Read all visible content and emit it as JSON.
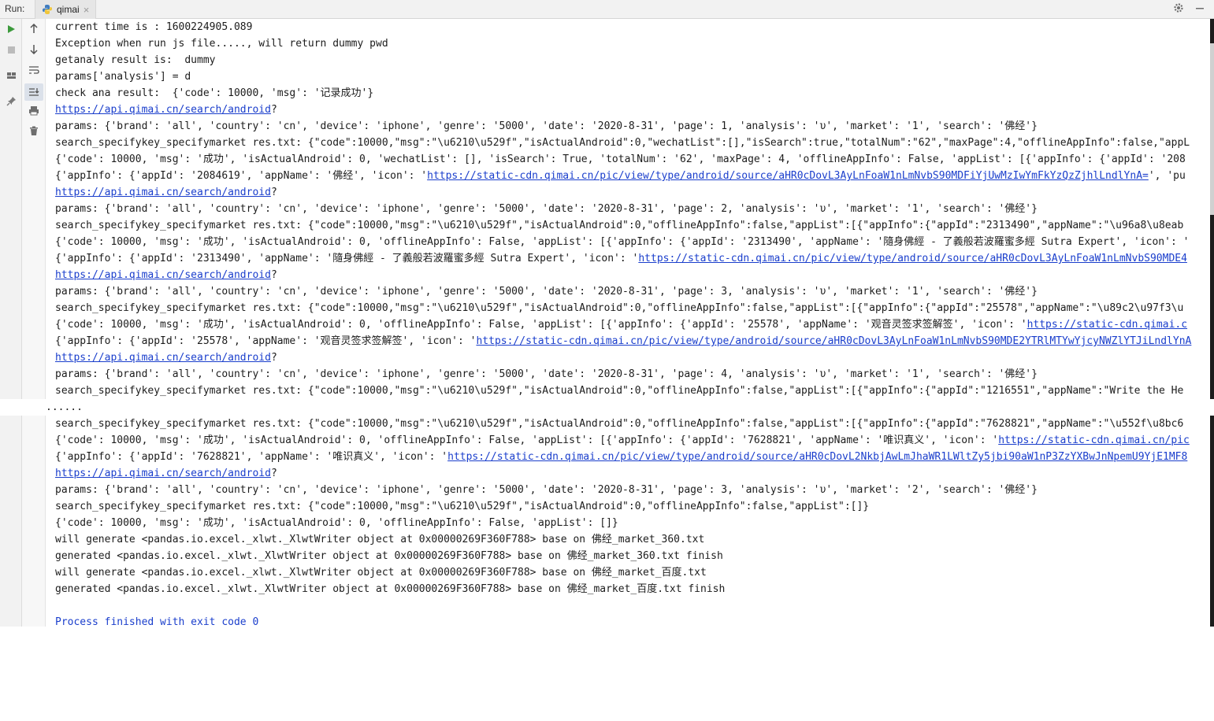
{
  "header": {
    "run_label": "Run:",
    "tab_label": "qimai"
  },
  "icons": {
    "gear": "gear-icon",
    "minimize": "minimize-icon"
  },
  "section1_lines": [
    {
      "parts": [
        {
          "t": "current time is : 1600224905.089"
        }
      ]
    },
    {
      "parts": [
        {
          "t": "Exception when run js file....., will return dummy pwd"
        }
      ]
    },
    {
      "parts": [
        {
          "t": "getanaly result is:  dummy"
        }
      ]
    },
    {
      "parts": [
        {
          "t": "params['analysis'] = d"
        }
      ]
    },
    {
      "parts": [
        {
          "t": "check ana result:  {'code': 10000, 'msg': '记录成功'}"
        }
      ]
    },
    {
      "parts": [
        {
          "t": "https://api.qimai.cn/search/android",
          "link": true
        },
        {
          "t": "?"
        }
      ]
    },
    {
      "parts": [
        {
          "t": "params: {'brand': 'all', 'country': 'cn', 'device': 'iphone', 'genre': '5000', 'date': '2020-8-31', 'page': 1, 'analysis': 'υ', 'market': '1', 'search': '佛经'}"
        }
      ]
    },
    {
      "parts": [
        {
          "t": "search_specifykey_specifymarket res.txt: {\"code\":10000,\"msg\":\"\\u6210\\u529f\",\"isActualAndroid\":0,\"wechatList\":[],\"isSearch\":true,\"totalNum\":\"62\",\"maxPage\":4,\"offlineAppInfo\":false,\"appL"
        }
      ]
    },
    {
      "parts": [
        {
          "t": "{'code': 10000, 'msg': '成功', 'isActualAndroid': 0, 'wechatList': [], 'isSearch': True, 'totalNum': '62', 'maxPage': 4, 'offlineAppInfo': False, 'appList': [{'appInfo': {'appId': '208"
        }
      ]
    },
    {
      "parts": [
        {
          "t": "{'appInfo': {'appId': '2084619', 'appName': '佛经', 'icon': '"
        },
        {
          "t": "https://static-cdn.qimai.cn/pic/view/type/android/source/aHR0cDovL3AyLnFoaW1nLmNvbS90MDFiYjUwMzIwYmFkYzQzZjhlLndlYnA=",
          "link": true
        },
        {
          "t": "', 'pu"
        }
      ]
    },
    {
      "parts": [
        {
          "t": "https://api.qimai.cn/search/android",
          "link": true
        },
        {
          "t": "?"
        }
      ]
    },
    {
      "parts": [
        {
          "t": "params: {'brand': 'all', 'country': 'cn', 'device': 'iphone', 'genre': '5000', 'date': '2020-8-31', 'page': 2, 'analysis': 'υ', 'market': '1', 'search': '佛经'}"
        }
      ]
    },
    {
      "parts": [
        {
          "t": "search_specifykey_specifymarket res.txt: {\"code\":10000,\"msg\":\"\\u6210\\u529f\",\"isActualAndroid\":0,\"offlineAppInfo\":false,\"appList\":[{\"appInfo\":{\"appId\":\"2313490\",\"appName\":\"\\u96a8\\u8eab"
        }
      ]
    },
    {
      "parts": [
        {
          "t": "{'code': 10000, 'msg': '成功', 'isActualAndroid': 0, 'offlineAppInfo': False, 'appList': [{'appInfo': {'appId': '2313490', 'appName': '隨身佛經 - 了義般若波羅蜜多經 Sutra Expert', 'icon': '"
        }
      ]
    },
    {
      "parts": [
        {
          "t": "{'appInfo': {'appId': '2313490', 'appName': '隨身佛經 - 了義般若波羅蜜多經 Sutra Expert', 'icon': '"
        },
        {
          "t": "https://static-cdn.qimai.cn/pic/view/type/android/source/aHR0cDovL3AyLnFoaW1nLmNvbS90MDE4",
          "link": true
        }
      ]
    },
    {
      "parts": [
        {
          "t": "https://api.qimai.cn/search/android",
          "link": true
        },
        {
          "t": "?"
        }
      ]
    },
    {
      "parts": [
        {
          "t": "params: {'brand': 'all', 'country': 'cn', 'device': 'iphone', 'genre': '5000', 'date': '2020-8-31', 'page': 3, 'analysis': 'υ', 'market': '1', 'search': '佛经'}"
        }
      ]
    },
    {
      "parts": [
        {
          "t": "search_specifykey_specifymarket res.txt: {\"code\":10000,\"msg\":\"\\u6210\\u529f\",\"isActualAndroid\":0,\"offlineAppInfo\":false,\"appList\":[{\"appInfo\":{\"appId\":\"25578\",\"appName\":\"\\u89c2\\u97f3\\u"
        }
      ]
    },
    {
      "parts": [
        {
          "t": "{'code': 10000, 'msg': '成功', 'isActualAndroid': 0, 'offlineAppInfo': False, 'appList': [{'appInfo': {'appId': '25578', 'appName': '观音灵签求签解签', 'icon': '"
        },
        {
          "t": "https://static-cdn.qimai.c",
          "link": true
        }
      ]
    },
    {
      "parts": [
        {
          "t": "{'appInfo': {'appId': '25578', 'appName': '观音灵签求签解签', 'icon': '"
        },
        {
          "t": "https://static-cdn.qimai.cn/pic/view/type/android/source/aHR0cDovL3AyLnFoaW1nLmNvbS90MDE2YTRlMTYwYjcyNWZlYTJiLndlYnA",
          "link": true
        }
      ]
    },
    {
      "parts": [
        {
          "t": "https://api.qimai.cn/search/android",
          "link": true
        },
        {
          "t": "?"
        }
      ]
    },
    {
      "parts": [
        {
          "t": "params: {'brand': 'all', 'country': 'cn', 'device': 'iphone', 'genre': '5000', 'date': '2020-8-31', 'page': 4, 'analysis': 'υ', 'market': '1', 'search': '佛经'}"
        }
      ]
    },
    {
      "parts": [
        {
          "t": "search_specifykey_specifymarket res.txt: {\"code\":10000,\"msg\":\"\\u6210\\u529f\",\"isActualAndroid\":0,\"offlineAppInfo\":false,\"appList\":[{\"appInfo\":{\"appId\":\"1216551\",\"appName\":\"Write the He"
        }
      ]
    }
  ],
  "ellipsis": "......",
  "section2_lines": [
    {
      "parts": [
        {
          "t": "search_specifykey_specifymarket res.txt: {\"code\":10000,\"msg\":\"\\u6210\\u529f\",\"isActualAndroid\":0,\"offlineAppInfo\":false,\"appList\":[{\"appInfo\":{\"appId\":\"7628821\",\"appName\":\"\\u552f\\u8bc6"
        }
      ]
    },
    {
      "parts": [
        {
          "t": "{'code': 10000, 'msg': '成功', 'isActualAndroid': 0, 'offlineAppInfo': False, 'appList': [{'appInfo': {'appId': '7628821', 'appName': '唯识真义', 'icon': '"
        },
        {
          "t": "https://static-cdn.qimai.cn/pic",
          "link": true
        }
      ]
    },
    {
      "parts": [
        {
          "t": "{'appInfo': {'appId': '7628821', 'appName': '唯识真义', 'icon': '"
        },
        {
          "t": "https://static-cdn.qimai.cn/pic/view/type/android/source/aHR0cDovL2NkbjAwLmJhaWR1LWltZy5jbi90aW1nP3ZzYXBwJnNpemU9YjE1MF8",
          "link": true
        }
      ]
    },
    {
      "parts": [
        {
          "t": "https://api.qimai.cn/search/android",
          "link": true
        },
        {
          "t": "?"
        }
      ]
    },
    {
      "parts": [
        {
          "t": "params: {'brand': 'all', 'country': 'cn', 'device': 'iphone', 'genre': '5000', 'date': '2020-8-31', 'page': 3, 'analysis': 'υ', 'market': '2', 'search': '佛经'}"
        }
      ]
    },
    {
      "parts": [
        {
          "t": "search_specifykey_specifymarket res.txt: {\"code\":10000,\"msg\":\"\\u6210\\u529f\",\"isActualAndroid\":0,\"offlineAppInfo\":false,\"appList\":[]}"
        }
      ]
    },
    {
      "parts": [
        {
          "t": "{'code': 10000, 'msg': '成功', 'isActualAndroid': 0, 'offlineAppInfo': False, 'appList': []}"
        }
      ]
    },
    {
      "parts": [
        {
          "t": "will generate <pandas.io.excel._xlwt._XlwtWriter object at 0x00000269F360F788> base on 佛经_market_360.txt"
        }
      ]
    },
    {
      "parts": [
        {
          "t": "generated <pandas.io.excel._xlwt._XlwtWriter object at 0x00000269F360F788> base on 佛经_market_360.txt finish"
        }
      ]
    },
    {
      "parts": [
        {
          "t": "will generate <pandas.io.excel._xlwt._XlwtWriter object at 0x00000269F360F788> base on 佛经_market_百度.txt"
        }
      ]
    },
    {
      "parts": [
        {
          "t": "generated <pandas.io.excel._xlwt._XlwtWriter object at 0x00000269F360F788> base on 佛经_market_百度.txt finish"
        }
      ]
    },
    {
      "parts": [
        {
          "t": ""
        }
      ]
    },
    {
      "parts": [
        {
          "t": "Process finished with exit code 0",
          "blue": true
        }
      ]
    }
  ]
}
